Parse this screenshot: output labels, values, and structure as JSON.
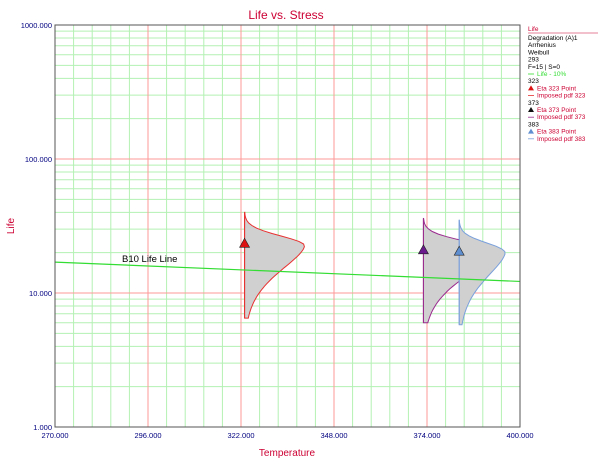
{
  "colors": {
    "title": "#cc0033",
    "axis_text": "#000080",
    "ylabel": "#cc0033",
    "xlabel": "#cc0033",
    "major_grid": "#ff9999",
    "minor_grid": "#b3f0b3",
    "life_line": "#33dd33",
    "pdf_323": "#e83030",
    "pdf_373": "#9a2a8e",
    "pdf_383": "#7aa0dc",
    "pdf_fill": "#d0d0d0",
    "marker_323": "#dd1111",
    "marker_373": "#6a1a8c",
    "marker_383": "#5f8fd0"
  },
  "chart_data": {
    "type": "scatter",
    "title": "Life vs. Stress",
    "xlabel": "Temperature",
    "ylabel": "Life",
    "xlim": [
      270,
      400
    ],
    "ylim": [
      1,
      1000
    ],
    "y_scale": "log",
    "x_ticks": [
      "270.000",
      "296.000",
      "322.000",
      "348.000",
      "374.000",
      "400.000"
    ],
    "x_tick_values": [
      270,
      296,
      322,
      348,
      374,
      400
    ],
    "y_ticks": [
      "1.000",
      "10.000",
      "100.000",
      "1000.000"
    ],
    "y_tick_values": [
      1,
      10,
      100,
      1000
    ],
    "grid": true,
    "life_line": {
      "label": "B10 Life Line",
      "points": [
        [
          270,
          17.0
        ],
        [
          400,
          12.2
        ]
      ]
    },
    "eta_points": [
      {
        "x": 323,
        "y": 23.5
      },
      {
        "x": 373,
        "y": 21.0
      },
      {
        "x": 383,
        "y": 20.5
      }
    ],
    "imposed_pdfs": [
      {
        "x": 323,
        "y_range": [
          6.5,
          40
        ],
        "mode": 22.5
      },
      {
        "x": 373,
        "y_range": [
          6.0,
          36
        ],
        "mode": 20.5
      },
      {
        "x": 383,
        "y_range": [
          5.8,
          35
        ],
        "mode": 20.0
      }
    ]
  },
  "legend": {
    "header": "Life",
    "lines": [
      "Degradation (A)1",
      "Arrhenius",
      "Weibull",
      "293",
      "F=15 | S=0",
      "Life - 10%",
      "323",
      "Eta 323 Point",
      "Imposed pdf 323",
      "373",
      "Eta 373 Point",
      "Imposed pdf 373",
      "383",
      "Eta 383 Point",
      "Imposed pdf 383"
    ]
  }
}
